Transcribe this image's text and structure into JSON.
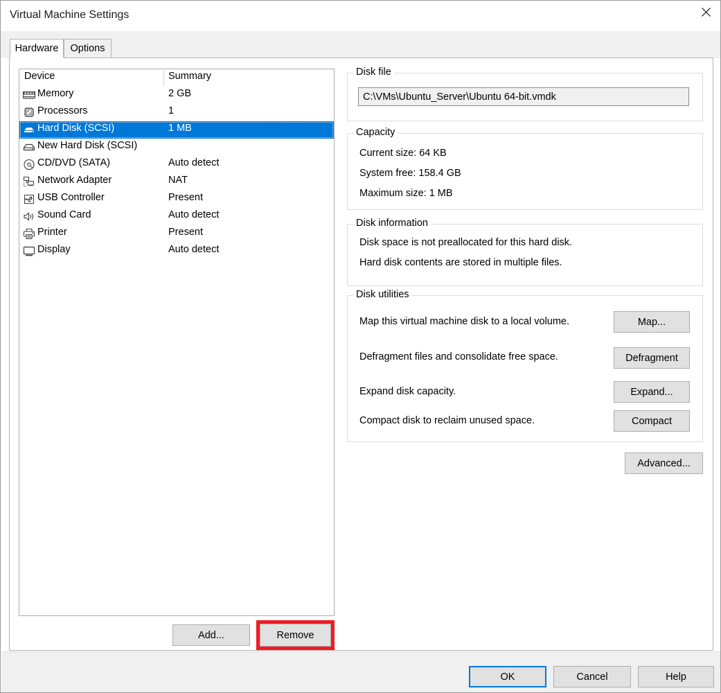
{
  "window": {
    "title": "Virtual Machine Settings",
    "close_icon": "close-icon"
  },
  "tabs": [
    {
      "label": "Hardware",
      "active": true
    },
    {
      "label": "Options",
      "active": false
    }
  ],
  "device_list": {
    "columns": [
      "Device",
      "Summary"
    ],
    "rows": [
      {
        "icon": "memory-icon",
        "device": "Memory",
        "summary": "2 GB",
        "selected": false
      },
      {
        "icon": "processor-icon",
        "device": "Processors",
        "summary": "1",
        "selected": false
      },
      {
        "icon": "hard-disk-icon",
        "device": "Hard Disk (SCSI)",
        "summary": "1 MB",
        "selected": true
      },
      {
        "icon": "hard-disk-icon",
        "device": "New Hard Disk (SCSI)",
        "summary": "",
        "selected": false
      },
      {
        "icon": "cd-dvd-icon",
        "device": "CD/DVD (SATA)",
        "summary": "Auto detect",
        "selected": false
      },
      {
        "icon": "network-adapter-icon",
        "device": "Network Adapter",
        "summary": "NAT",
        "selected": false
      },
      {
        "icon": "usb-icon",
        "device": "USB Controller",
        "summary": "Present",
        "selected": false
      },
      {
        "icon": "sound-card-icon",
        "device": "Sound Card",
        "summary": "Auto detect",
        "selected": false
      },
      {
        "icon": "printer-icon",
        "device": "Printer",
        "summary": "Present",
        "selected": false
      },
      {
        "icon": "display-icon",
        "device": "Display",
        "summary": "Auto detect",
        "selected": false
      }
    ]
  },
  "list_buttons": {
    "add": "Add...",
    "remove": "Remove",
    "remove_highlight_color": "#ee1c25"
  },
  "disk_file": {
    "legend": "Disk file",
    "path": "C:\\VMs\\Ubuntu_Server\\Ubuntu 64-bit.vmdk"
  },
  "capacity": {
    "legend": "Capacity",
    "lines": [
      "Current size: 64 KB",
      "System free: 158.4 GB",
      "Maximum size: 1 MB"
    ]
  },
  "disk_information": {
    "legend": "Disk information",
    "lines": [
      "Disk space is not preallocated for this hard disk.",
      "Hard disk contents are stored in multiple files."
    ]
  },
  "disk_utilities": {
    "legend": "Disk utilities",
    "items": [
      {
        "label": "Map this virtual machine disk to a local volume.",
        "button": "Map..."
      },
      {
        "label": "Defragment files and consolidate free space.",
        "button": "Defragment"
      },
      {
        "label": "Expand disk capacity.",
        "button": "Expand..."
      },
      {
        "label": "Compact disk to reclaim unused space.",
        "button": "Compact"
      }
    ]
  },
  "advanced_button": "Advanced...",
  "footer": {
    "ok": "OK",
    "cancel": "Cancel",
    "help": "Help",
    "default_button_color": "#0078d7"
  },
  "colors": {
    "selection_blue": "#0078d7",
    "highlight_red": "#ee1c25",
    "dialog_gray": "#f0f0f0",
    "button_face": "#e1e1e1"
  }
}
